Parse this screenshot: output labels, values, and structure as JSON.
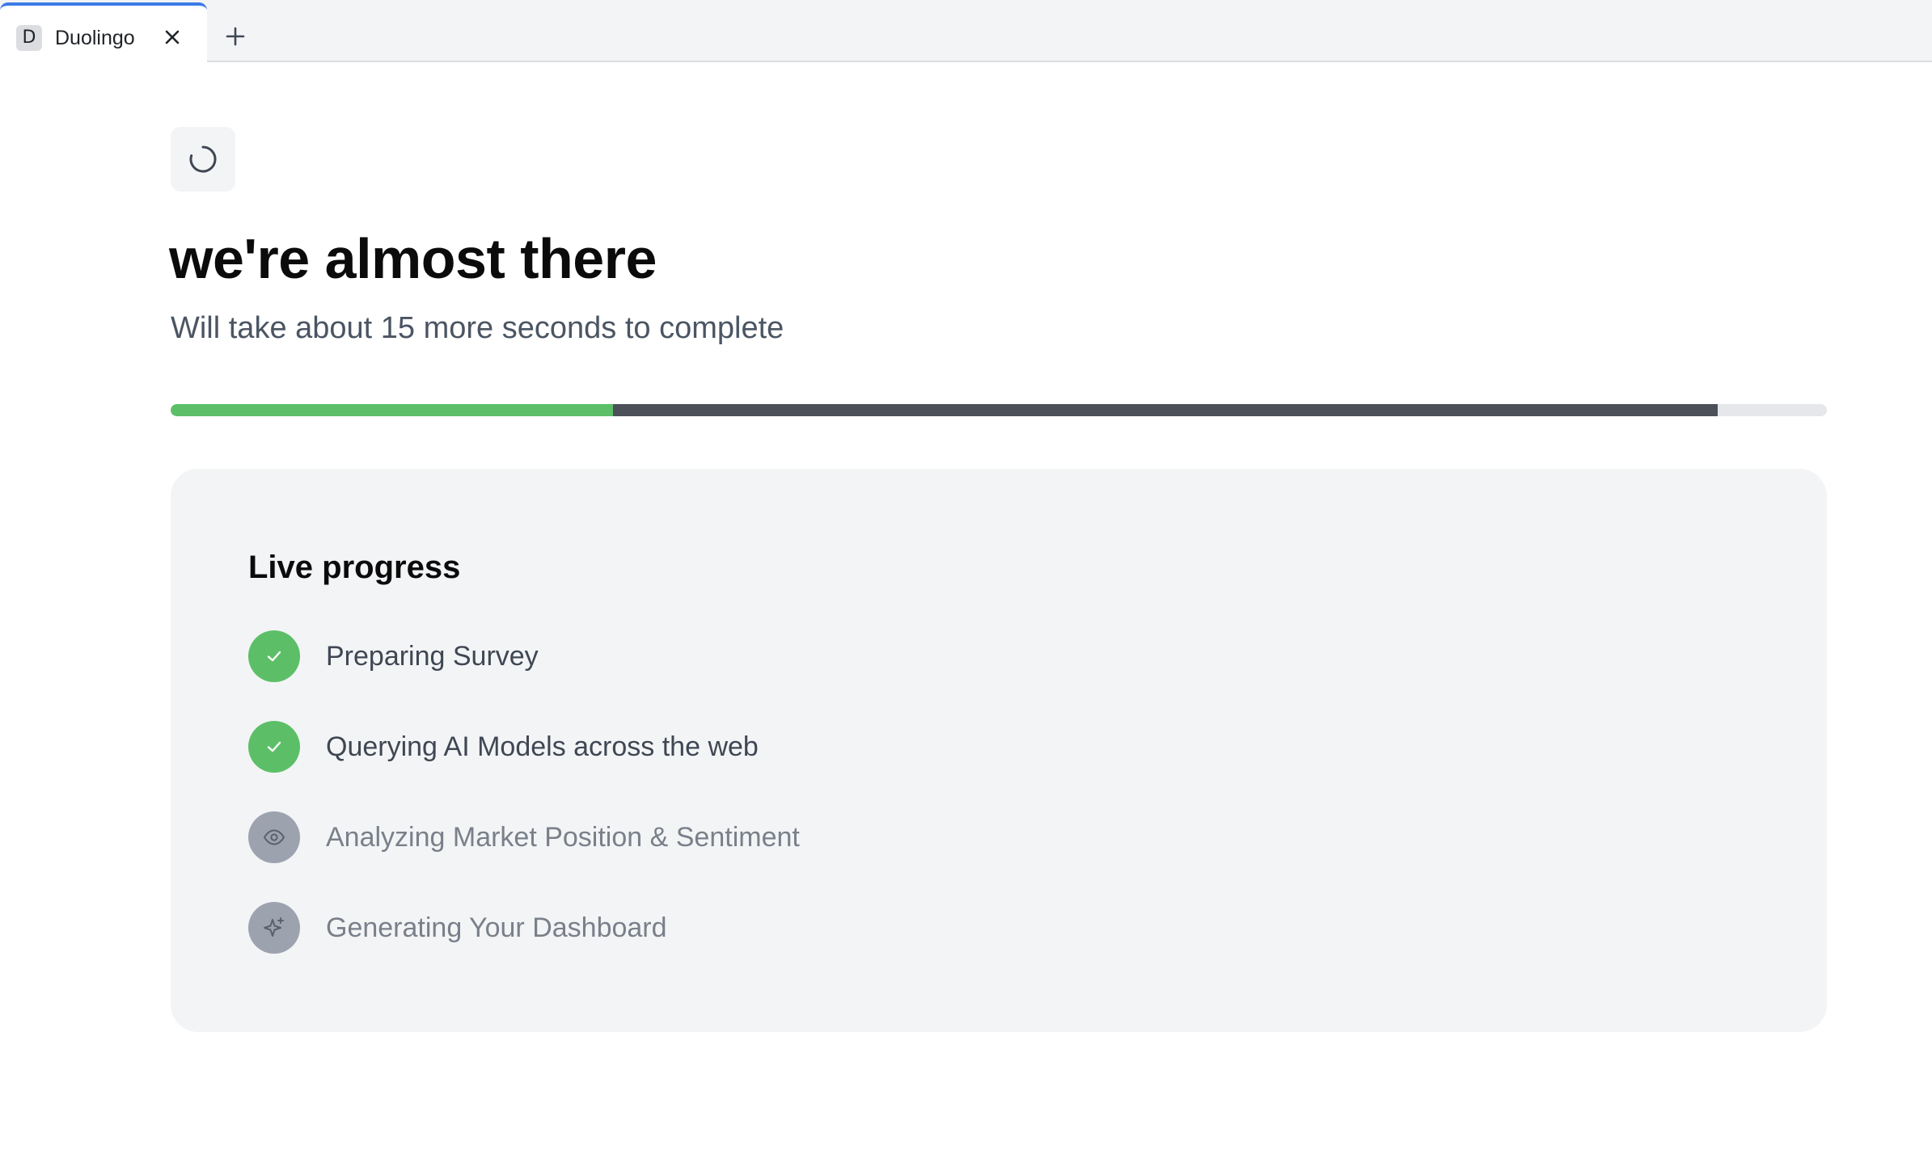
{
  "browser": {
    "tabs": [
      {
        "favicon_letter": "D",
        "title": "Duolingo",
        "active": true
      }
    ],
    "new_tab_label": "+"
  },
  "page": {
    "headline": "we're almost there",
    "subheadline": "Will take about 15 more seconds to complete",
    "progress": {
      "completed_fraction": 0.267,
      "in_progress_fraction": 0.667
    },
    "live_progress": {
      "title": "Live progress",
      "steps": [
        {
          "label": "Preparing Survey",
          "status": "done",
          "icon": "check-icon"
        },
        {
          "label": "Querying AI Models across the web",
          "status": "done",
          "icon": "check-icon"
        },
        {
          "label": "Analyzing Market Position & Sentiment",
          "status": "pending",
          "icon": "eye-icon"
        },
        {
          "label": "Generating Your Dashboard",
          "status": "pending",
          "icon": "sparkle-icon"
        }
      ]
    }
  },
  "colors": {
    "accent_green": "#5cbf67",
    "progress_active": "#4b5059",
    "pending_gray": "#9ca3af",
    "tab_indicator": "#3b7ae6"
  }
}
